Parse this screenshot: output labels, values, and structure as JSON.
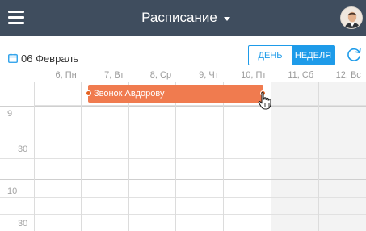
{
  "header": {
    "title": "Расписание",
    "menu_icon": "hamburger-menu-icon",
    "dropdown_icon": "caret-down-icon",
    "avatar_icon": "user-avatar"
  },
  "toolbar": {
    "date_icon": "calendar-icon",
    "date_label": "06 Февраль",
    "view_day_label": "ДЕНЬ",
    "view_week_label": "НЕДЕЛЯ",
    "active_view": "НЕДЕЛЯ",
    "refresh_icon": "refresh-icon"
  },
  "calendar": {
    "days": [
      "6, Пн",
      "7, Вт",
      "8, Ср",
      "9, Чт",
      "10, Пт",
      "11, Сб",
      "12, Вс"
    ],
    "weekend_days": [
      "11, Сб",
      "12, Вс"
    ],
    "time_labels": [
      "9",
      "30",
      "10",
      "30"
    ],
    "event": {
      "title": "Звонок Авдорову",
      "start_day": "7, Вт",
      "end_day": "10, Пт",
      "color": "#f07b4f"
    }
  },
  "colors": {
    "header_bg": "#3f4d5e",
    "accent": "#1e9be9",
    "event": "#f07b4f",
    "weekend_bg": "#f3f3f3"
  }
}
